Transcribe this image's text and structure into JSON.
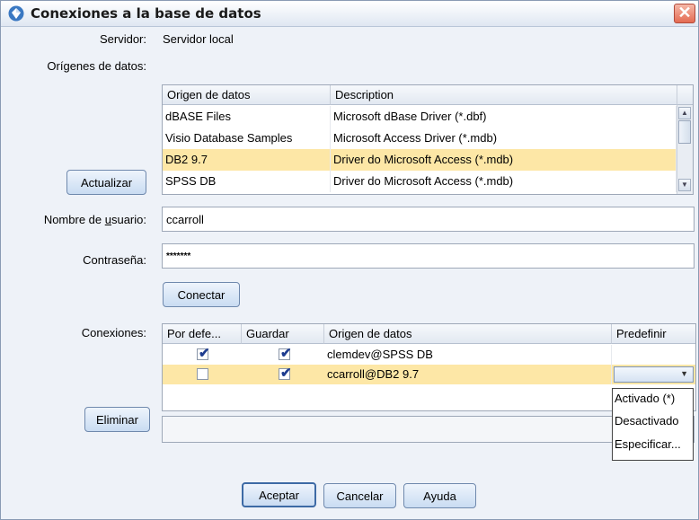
{
  "window": {
    "title": "Conexiones a la base de datos",
    "close_glyph": "✕"
  },
  "server": {
    "label": "Servidor:",
    "value": "Servidor local"
  },
  "data_sources": {
    "label": "Orígenes de datos:",
    "refresh_label": "Actualizar",
    "columns": [
      "Origen de datos",
      "Description"
    ],
    "rows": [
      {
        "name": "dBASE Files",
        "driver": "Microsoft dBase Driver (*.dbf)"
      },
      {
        "name": "Visio Database Samples",
        "driver": "Microsoft Access Driver (*.mdb)"
      },
      {
        "name": "DB2 9.7",
        "driver": "Driver do Microsoft Access (*.mdb)"
      },
      {
        "name": "SPSS DB",
        "driver": "Driver do Microsoft Access (*.mdb)"
      }
    ],
    "selected_index": 2
  },
  "username": {
    "label": "Nombre de usuario:",
    "value": "ccarroll"
  },
  "password": {
    "label": "Contraseña:",
    "value": "*******"
  },
  "connect_label": "Conectar",
  "connections": {
    "label": "Conexiones:",
    "delete_label": "Eliminar",
    "columns": [
      "Por defe...",
      "Guardar",
      "Origen de datos",
      "Predefinir"
    ],
    "rows": [
      {
        "default": true,
        "save": true,
        "source": "clemdev@SPSS DB",
        "preset": ""
      },
      {
        "default": false,
        "save": true,
        "source": "ccarroll@DB2 9.7",
        "preset": ""
      }
    ],
    "selected_index": 1,
    "preset_options": [
      "Activado (*)",
      "Desactivado",
      "Especificar..."
    ]
  },
  "footer": {
    "ok_label": "Aceptar",
    "cancel_label": "Cancelar",
    "help_label": "Ayuda"
  },
  "colors": {
    "selection": "#fde7a6",
    "check": "#1d3c8f",
    "titlebar": "#dfe7f2"
  },
  "icons": {
    "app": "database-diamond-icon",
    "close": "close-icon",
    "check": "checkmark-icon",
    "dropdown": "chevron-down-icon"
  }
}
